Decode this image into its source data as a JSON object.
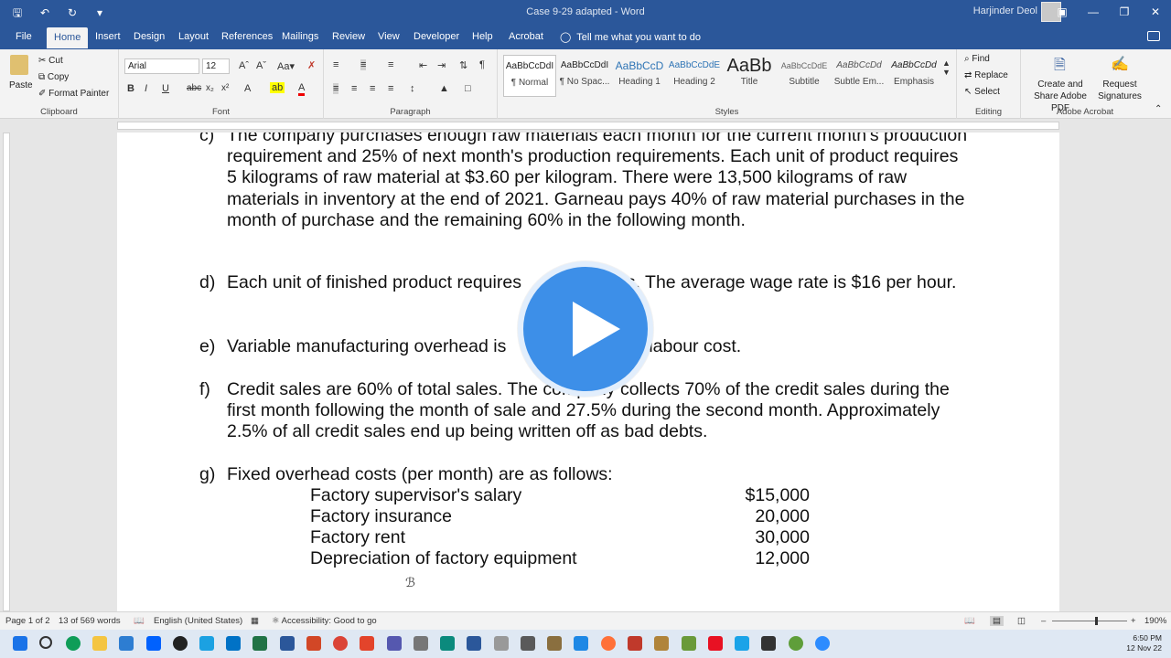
{
  "window": {
    "title": "Case 9-29 adapted  -  Word",
    "user": "Harjinder Deol"
  },
  "tabs": [
    "File",
    "Home",
    "Insert",
    "Design",
    "Layout",
    "References",
    "Mailings",
    "Review",
    "View",
    "Developer",
    "Help",
    "Acrobat"
  ],
  "tell_me": "Tell me what you want to do",
  "clipboard": {
    "paste": "Paste",
    "cut": "Cut",
    "copy": "Copy",
    "format_painter": "Format Painter",
    "label": "Clipboard"
  },
  "font": {
    "name": "Arial",
    "size": "12",
    "label": "Font"
  },
  "paragraph": {
    "label": "Paragraph"
  },
  "styles": {
    "label": "Styles",
    "items": [
      {
        "preview": "AaBbCcDdI",
        "name": "¶ Normal"
      },
      {
        "preview": "AaBbCcDdI",
        "name": "¶ No Spac..."
      },
      {
        "preview": "AaBbCcD",
        "name": "Heading 1"
      },
      {
        "preview": "AaBbCcDdE",
        "name": "Heading 2"
      },
      {
        "preview": "AaBb",
        "name": "Title"
      },
      {
        "preview": "AaBbCcDdE",
        "name": "Subtitle"
      },
      {
        "preview": "AaBbCcDd",
        "name": "Subtle Em..."
      },
      {
        "preview": "AaBbCcDd",
        "name": "Emphasis"
      }
    ]
  },
  "editing": {
    "find": "Find",
    "replace": "Replace",
    "select": "Select",
    "label": "Editing"
  },
  "acrobat": {
    "create_share": "Create and Share Adobe PDF",
    "request_sig": "Request Signatures",
    "label": "Adobe Acrobat"
  },
  "document": {
    "items": [
      {
        "label": "c)",
        "text": "The company purchases enough raw materials each month for the current month's production requirement and 25% of next month's production requirements. Each unit of product requires 5 kilograms of raw material at $3.60 per kilogram. There were 13,500 kilograms of raw materials in inventory at the end of 2021. Garneau pays 40% of raw material purchases in the month of purchase and the remaining 60% in the following month."
      },
      {
        "label": "d)",
        "text": "Each unit of finished product requires                ours. The average wage rate is $16 per hour."
      },
      {
        "label": "e)",
        "text": "Variable manufacturing overhead is                         ct labour cost."
      },
      {
        "label": "f)",
        "text": "Credit sales are 60% of total sales. The company collects 70% of the credit sales during the first month following the month of sale and 27.5% during the second month. Approximately 2.5% of all credit sales end up being written off as bad debts."
      },
      {
        "label": "g)",
        "text": "Fixed overhead costs (per month) are as follows:"
      }
    ],
    "fixed_overhead": [
      {
        "item": "Factory supervisor's salary",
        "amount": "$15,000"
      },
      {
        "item": "Factory insurance",
        "amount": "20,000"
      },
      {
        "item": "Factory rent",
        "amount": "30,000"
      },
      {
        "item": "Depreciation of factory equipment",
        "amount": "12,000"
      }
    ]
  },
  "status": {
    "page": "Page 1 of 2",
    "words": "13 of 569 words",
    "language": "English (United States)",
    "accessibility": "Accessibility: Good to go",
    "zoom": "190%"
  },
  "clock": {
    "time": "6:50 PM",
    "date": "12 Nov 22"
  }
}
